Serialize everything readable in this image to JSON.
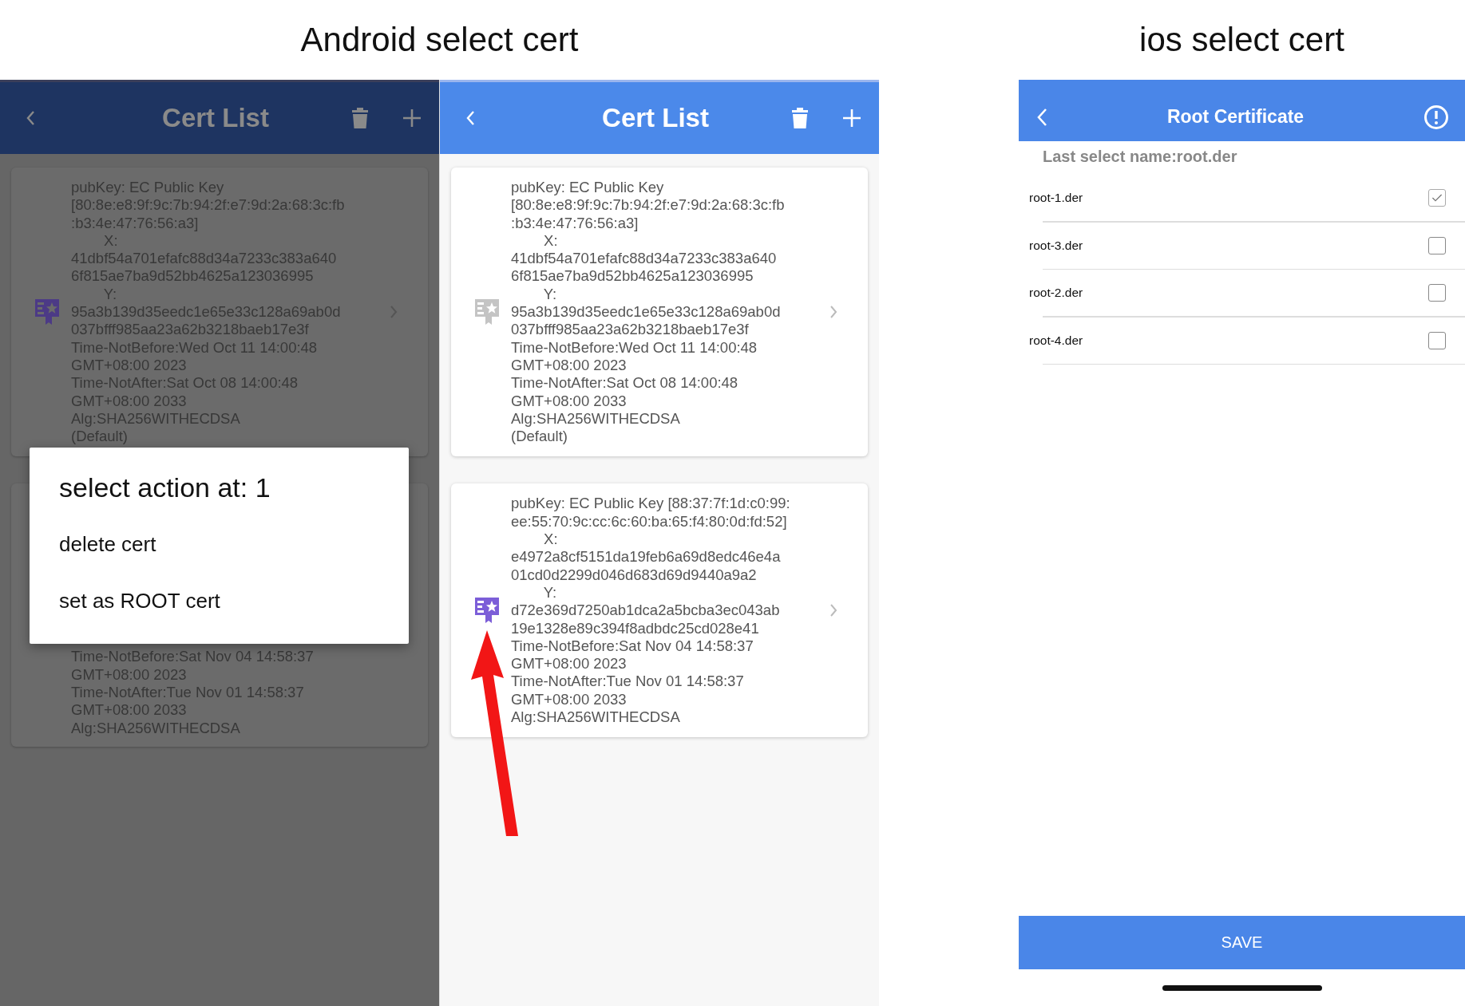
{
  "android": {
    "heading": "Android select cert",
    "screens": [
      {
        "dimmed": true,
        "header": {
          "title": "Cert List"
        },
        "cards": [
          {
            "icon_shown": true,
            "is_root": true,
            "lines": [
              "pubKey: EC Public Key",
              "[80:8e:e8:9f:9c:7b:94:2f:e7:9d:2a:68:3c:fb",
              ":b3:4e:47:76:56:a3]",
              "        X:",
              "41dbf54a701efafc88d34a7233c383a640",
              "6f815ae7ba9d52bb4625a123036995",
              "        Y:",
              "95a3b139d35eedc1e65e33c128a69ab0d",
              "037bfff985aa23a62b3218baeb17e3f",
              "Time-NotBefore:Wed Oct 11 14:00:48",
              "GMT+08:00 2023",
              "Time-NotAfter:Sat Oct 08 14:00:48",
              "GMT+08:00 2033",
              "Alg:SHA256WITHECDSA",
              "(Default)"
            ]
          },
          {
            "icon_shown": false,
            "lines": [
              "Time-NotBefore:Sat Nov 04 14:58:37",
              "GMT+08:00 2023",
              "Time-NotAfter:Tue Nov 01 14:58:37",
              "GMT+08:00 2033",
              "Alg:SHA256WITHECDSA"
            ]
          }
        ],
        "dialog": {
          "title": "select action at: 1",
          "items": [
            "delete cert",
            "set as ROOT cert"
          ]
        }
      },
      {
        "dimmed": false,
        "header": {
          "title": "Cert List"
        },
        "cards": [
          {
            "icon_shown": true,
            "is_root": false,
            "lines": [
              "pubKey: EC Public Key",
              "[80:8e:e8:9f:9c:7b:94:2f:e7:9d:2a:68:3c:fb",
              ":b3:4e:47:76:56:a3]",
              "        X:",
              "41dbf54a701efafc88d34a7233c383a640",
              "6f815ae7ba9d52bb4625a123036995",
              "        Y:",
              "95a3b139d35eedc1e65e33c128a69ab0d",
              "037bfff985aa23a62b3218baeb17e3f",
              "Time-NotBefore:Wed Oct 11 14:00:48",
              "GMT+08:00 2023",
              "Time-NotAfter:Sat Oct 08 14:00:48",
              "GMT+08:00 2033",
              "Alg:SHA256WITHECDSA",
              "(Default)"
            ]
          },
          {
            "icon_shown": true,
            "is_root": true,
            "lines": [
              "pubKey: EC Public Key [88:37:7f:1d:c0:99:",
              "ee:55:70:9c:cc:6c:60:ba:65:f4:80:0d:fd:52]",
              "        X:",
              "e4972a8cf5151da19feb6a69d8edc46e4a",
              "01cd0d2299d046d683d69d9440a9a2",
              "        Y:",
              "d72e369d7250ab1dca2a5bcba3ec043ab",
              "19e1328e89c394f8adbdc25cd028e41",
              "Time-NotBefore:Sat Nov 04 14:58:37",
              "GMT+08:00 2023",
              "Time-NotAfter:Tue Nov 01 14:58:37",
              "GMT+08:00 2033",
              "Alg:SHA256WITHECDSA"
            ]
          }
        ]
      }
    ]
  },
  "ios": {
    "heading": "ios select cert",
    "header": {
      "title": "Root Certificate"
    },
    "subtitle": "Last select name:root.der",
    "rows": [
      {
        "name": "root-1.der",
        "checked": true
      },
      {
        "name": "root-3.der",
        "checked": false
      },
      {
        "name": "root-2.der",
        "checked": false
      },
      {
        "name": "root-4.der",
        "checked": false
      }
    ],
    "save_button": "SAVE"
  }
}
